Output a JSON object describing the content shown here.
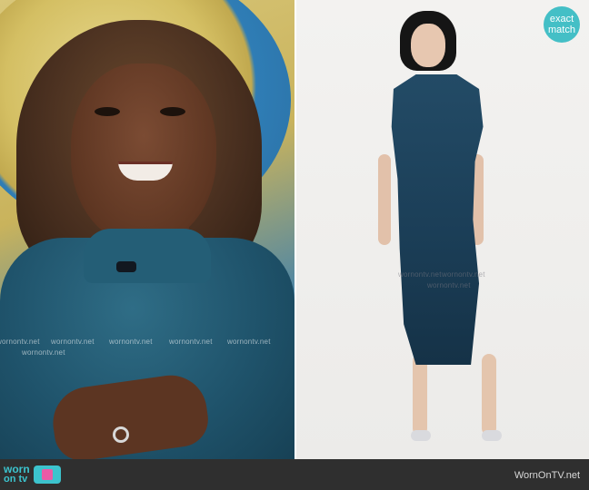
{
  "badge": {
    "line1": "exact",
    "line2": "match"
  },
  "watermarks": {
    "left": [
      "wornontv.net",
      "wornontv.net",
      "wornontv.net",
      "wornontv.net",
      "wornontv.net",
      "wornontv.net"
    ],
    "right": [
      "wornontv.net",
      "wornontv.net",
      "wornontv.net"
    ]
  },
  "footer": {
    "logo_line1": "worn",
    "logo_line2": "on tv",
    "site": "WornOnTV.net"
  },
  "colors": {
    "accent": "#44bfc6",
    "footer_bg": "#2f2f2f",
    "dress": "#1b3e57"
  },
  "icons": [
    "tv-logo-icon"
  ]
}
